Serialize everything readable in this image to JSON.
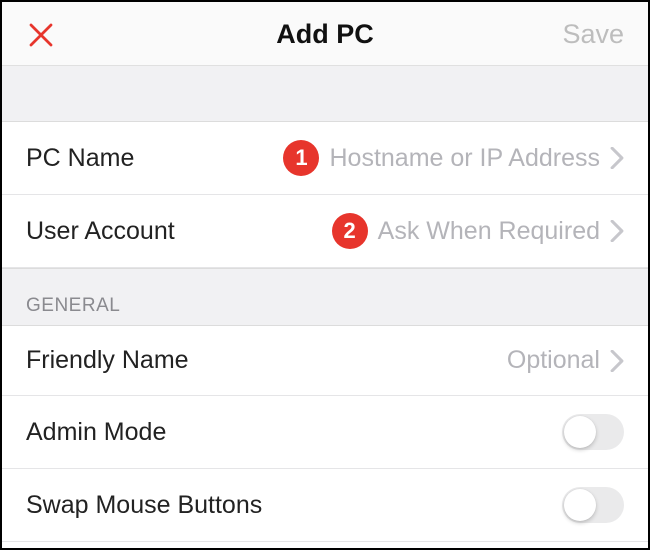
{
  "header": {
    "title": "Add PC",
    "save_label": "Save"
  },
  "rows": {
    "pc_name": {
      "label": "PC Name",
      "value": "Hostname or IP Address",
      "annotation": "1"
    },
    "user_account": {
      "label": "User Account",
      "value": "Ask When Required",
      "annotation": "2"
    },
    "friendly_name": {
      "label": "Friendly Name",
      "value": "Optional"
    },
    "admin_mode": {
      "label": "Admin Mode",
      "toggle": false
    },
    "swap_mouse": {
      "label": "Swap Mouse Buttons",
      "toggle": false
    }
  },
  "sections": {
    "general": "GENERAL"
  }
}
